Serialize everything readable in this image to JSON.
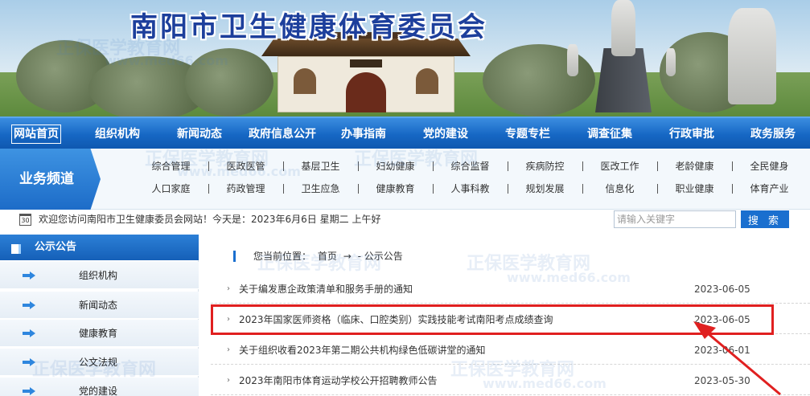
{
  "site": {
    "title": "南阳市卫生健康体育委员会"
  },
  "main_nav": {
    "items": [
      {
        "label": "网站首页",
        "active": true
      },
      {
        "label": "组织机构"
      },
      {
        "label": "新闻动态"
      },
      {
        "label": "政府信息公开"
      },
      {
        "label": "办事指南"
      },
      {
        "label": "党的建设"
      },
      {
        "label": "专题专栏"
      },
      {
        "label": "调查征集"
      },
      {
        "label": "行政审批"
      },
      {
        "label": "政务服务"
      }
    ]
  },
  "business_channel": {
    "label": "业务频道",
    "row1": [
      "综合管理",
      "医政医管",
      "基层卫生",
      "妇幼健康",
      "综合监督",
      "疾病防控",
      "医改工作",
      "老龄健康",
      "全民健身"
    ],
    "row2": [
      "人口家庭",
      "药政管理",
      "卫生应急",
      "健康教育",
      "人事科教",
      "规划发展",
      "信息化",
      "职业健康",
      "体育产业"
    ]
  },
  "welcome": {
    "calendar_icon_text": "30",
    "text": "欢迎您访问南阳市卫生健康委员会网站！今天是：2023年6月6日 星期二 上午好"
  },
  "search": {
    "placeholder": "请输入关键字",
    "button_label": "搜 索"
  },
  "sidebar": {
    "header": "公示公告",
    "items": [
      {
        "label": "组织机构"
      },
      {
        "label": "新闻动态"
      },
      {
        "label": "健康教育"
      },
      {
        "label": "公文法规"
      },
      {
        "label": "党的建设"
      }
    ]
  },
  "breadcrumb": {
    "prefix": "您当前位置：",
    "home": "首页",
    "sep": "→",
    "current": "- 公示公告"
  },
  "news": [
    {
      "title": "关于编发惠企政策清单和服务手册的通知",
      "date": "2023-06-05"
    },
    {
      "title": "2023年国家医师资格（临床、口腔类别）实践技能考试南阳考点成绩查询",
      "date": "2023-06-05",
      "highlighted": true
    },
    {
      "title": "关于组织收看2023年第二期公共机构绿色低碳讲堂的通知",
      "date": "2023-06-01"
    },
    {
      "title": "2023年南阳市体育运动学校公开招聘教师公告",
      "date": "2023-05-30"
    }
  ],
  "watermark": {
    "cn": "正保医学教育网",
    "url": "www.med66.com"
  },
  "colors": {
    "nav_blue": "#1667c4",
    "title_blue": "#1d3f9c",
    "highlight_red": "#e02020"
  }
}
